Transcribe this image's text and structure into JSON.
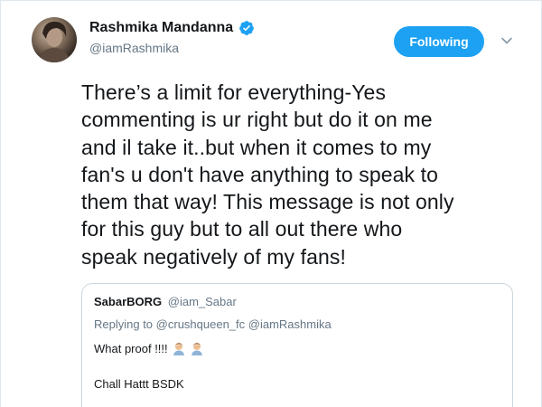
{
  "tweet": {
    "author": {
      "display_name": "Rashmika Mandanna",
      "handle": "@iamRashmika",
      "verified": true,
      "verified_icon": "verified-badge-icon",
      "avatar_icon": "avatar"
    },
    "follow_button_label": "Following",
    "menu_icon": "chevron-down-icon",
    "accent_color": "#1da1f2",
    "text_lines": [
      "There’s a limit for everything-Yes",
      "commenting is ur right but do it on me",
      "and il take it..but when it comes to my",
      "fan's u don't have anything to speak to",
      "them that way! This message is not only",
      "for this guy but to all out there who",
      "speak negatively of my fans!"
    ],
    "quoted": {
      "display_name": "SabarBORG",
      "handle": "@iam_Sabar",
      "replying_to_prefix": "Replying to",
      "replying_to": "@crushqueen_fc @iamRashmika",
      "line1": "What proof !!!!",
      "line1_emoji": "man-facepalming-emoji",
      "line2": "Chall Hattt BSDK"
    }
  }
}
